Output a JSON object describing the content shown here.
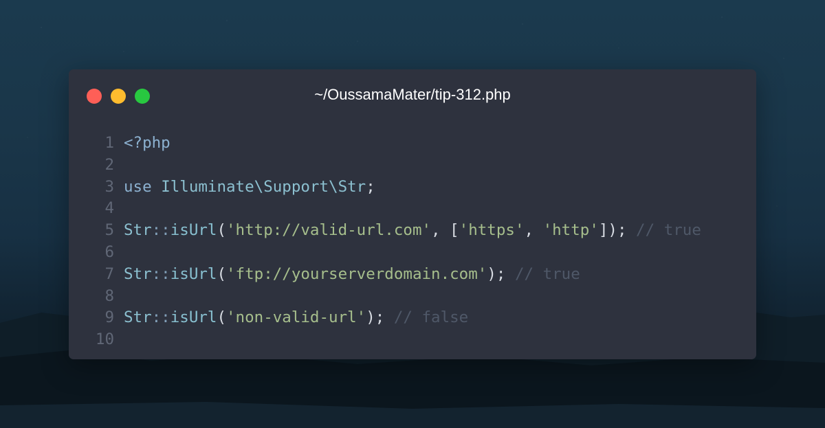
{
  "window": {
    "title": "~/OussamaMater/tip-312.php",
    "controls": [
      "close",
      "minimize",
      "maximize"
    ],
    "colors": {
      "close": "#fe5f57",
      "minimize": "#febc2e",
      "maximize": "#28c840",
      "background": "#2e323e"
    }
  },
  "code": {
    "language": "php",
    "lines": [
      {
        "number": "1",
        "tokens": [
          "<?php"
        ]
      },
      {
        "number": "2",
        "tokens": []
      },
      {
        "number": "3",
        "tokens": [
          "use",
          " ",
          "Illuminate\\Support\\Str",
          ";"
        ]
      },
      {
        "number": "4",
        "tokens": []
      },
      {
        "number": "5",
        "tokens": [
          "Str",
          "::",
          "isUrl",
          "(",
          "'http://valid-url.com'",
          ", [",
          "'https'",
          ", ",
          "'http'",
          "]);",
          " // true"
        ]
      },
      {
        "number": "6",
        "tokens": []
      },
      {
        "number": "7",
        "tokens": [
          "Str",
          "::",
          "isUrl",
          "(",
          "'ftp://yourserverdomain.com'",
          ");",
          " // true"
        ]
      },
      {
        "number": "8",
        "tokens": []
      },
      {
        "number": "9",
        "tokens": [
          "Str",
          "::",
          "isUrl",
          "(",
          "'non-valid-url'",
          ");",
          " // false"
        ]
      },
      {
        "number": "10",
        "tokens": []
      }
    ]
  }
}
